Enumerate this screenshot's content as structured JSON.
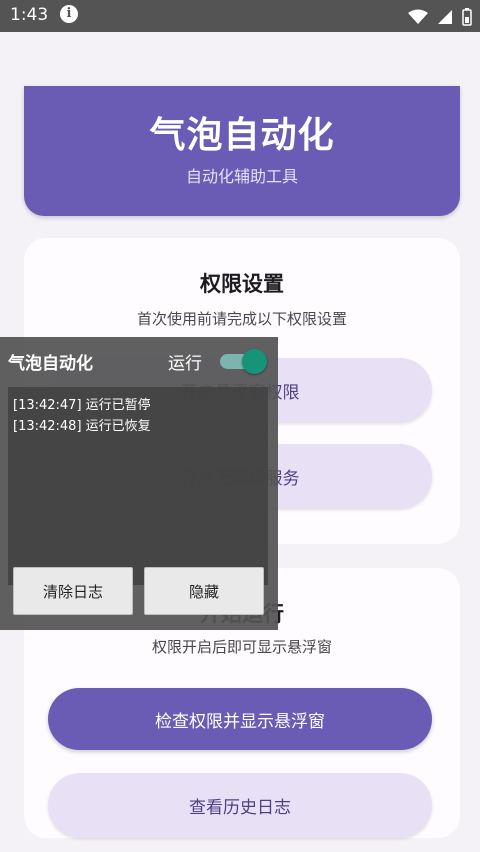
{
  "status_bar": {
    "time": "1:43"
  },
  "header": {
    "title": "气泡自动化",
    "subtitle": "自动化辅助工具"
  },
  "permissions_card": {
    "title": "权限设置",
    "description": "首次使用前请完成以下权限设置",
    "overlay_button": "开启悬浮窗权限",
    "accessibility_button": "开启无障碍服务"
  },
  "run_card": {
    "title": "开始运行",
    "description": "权限开启后即可显示悬浮窗",
    "check_button": "检查权限并显示悬浮窗",
    "history_button": "查看历史日志"
  },
  "overlay": {
    "title": "气泡自动化",
    "run_label": "运行",
    "run_enabled": true,
    "logs": [
      "[13:42:47] 运行已暂停",
      "[13:42:48] 运行已恢复"
    ],
    "clear_button": "清除日志",
    "hide_button": "隐藏"
  },
  "colors": {
    "primary": "#6a5bb4",
    "tonal": "#e8e1f6",
    "background": "#f4f2f7",
    "toggle_on": "#169479"
  }
}
